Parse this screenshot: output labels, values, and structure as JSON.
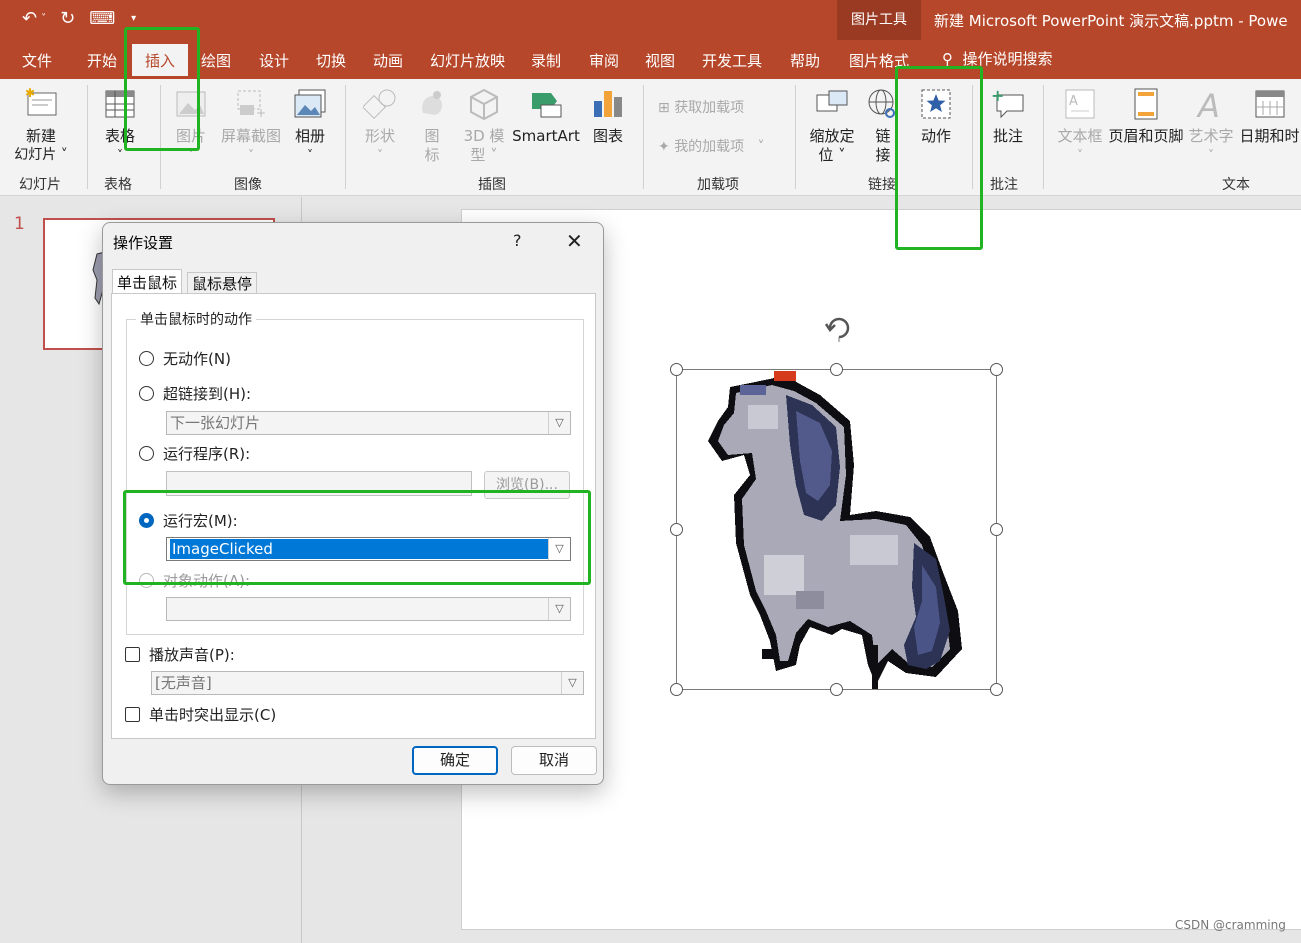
{
  "qat": {
    "undo": "↶",
    "redo": "↻",
    "present": "⌨",
    "more": "▾"
  },
  "title": {
    "context_tools": "图片工具",
    "document": "新建 Microsoft PowerPoint 演示文稿.pptm  -  Powe"
  },
  "tabs": [
    "文件",
    "开始",
    "插入",
    "绘图",
    "设计",
    "切换",
    "动画",
    "幻灯片放映",
    "录制",
    "审阅",
    "视图",
    "开发工具",
    "帮助",
    "图片格式"
  ],
  "tell_me": "操作说明搜索",
  "ribbon": {
    "new_slide": [
      "新建",
      "幻灯片 ˅"
    ],
    "table": [
      "表格",
      "˅"
    ],
    "picture": [
      "图片",
      "˅"
    ],
    "screenshot": [
      "屏幕截图",
      "˅"
    ],
    "album": [
      "相册",
      "˅"
    ],
    "shapes": [
      "形状",
      "˅"
    ],
    "icons": [
      "图",
      "标"
    ],
    "model3d": [
      "3D 模",
      "型 ˅"
    ],
    "smartart": "SmartArt",
    "chart": "图表",
    "get_addins": "获取加载项",
    "my_addins": "我的加载项",
    "zoom": [
      "缩放定",
      "位 ˅"
    ],
    "link": [
      "链",
      "接"
    ],
    "action": "动作",
    "comment": "批注",
    "textbox": [
      "文本框",
      "˅"
    ],
    "header_footer": "页眉和页脚",
    "wordart": [
      "艺术字",
      "˅"
    ],
    "datetime": "日期和时",
    "groups": {
      "slides": "幻灯片",
      "tables": "表格",
      "images": "图像",
      "illustrations": "插图",
      "addins": "加载项",
      "links": "链接",
      "comments": "批注",
      "text": "文本"
    }
  },
  "slide_panel": {
    "number": "1"
  },
  "dialog": {
    "title": "操作设置",
    "help": "?",
    "close": "✕",
    "tab_click": "单击鼠标",
    "tab_hover": "鼠标悬停",
    "group_label": "单击鼠标时的动作",
    "opt_none": "无动作(N)",
    "opt_hyperlink": "超链接到(H):",
    "hyperlink_value": "下一张幻灯片",
    "opt_run_program": "运行程序(R):",
    "browse": "浏览(B)...",
    "opt_run_macro": "运行宏(M):",
    "macro_value": "ImageClicked",
    "opt_object_action": "对象动作(A):",
    "play_sound": "播放声音(P):",
    "sound_value": "[无声音]",
    "highlight_click": "单击时突出显示(C)",
    "ok": "确定",
    "cancel": "取消"
  },
  "watermark": "CSDN @cramming",
  "colors": {
    "brand": "#b7472a",
    "annotation": "#22b322",
    "selection": "#0078d7"
  }
}
